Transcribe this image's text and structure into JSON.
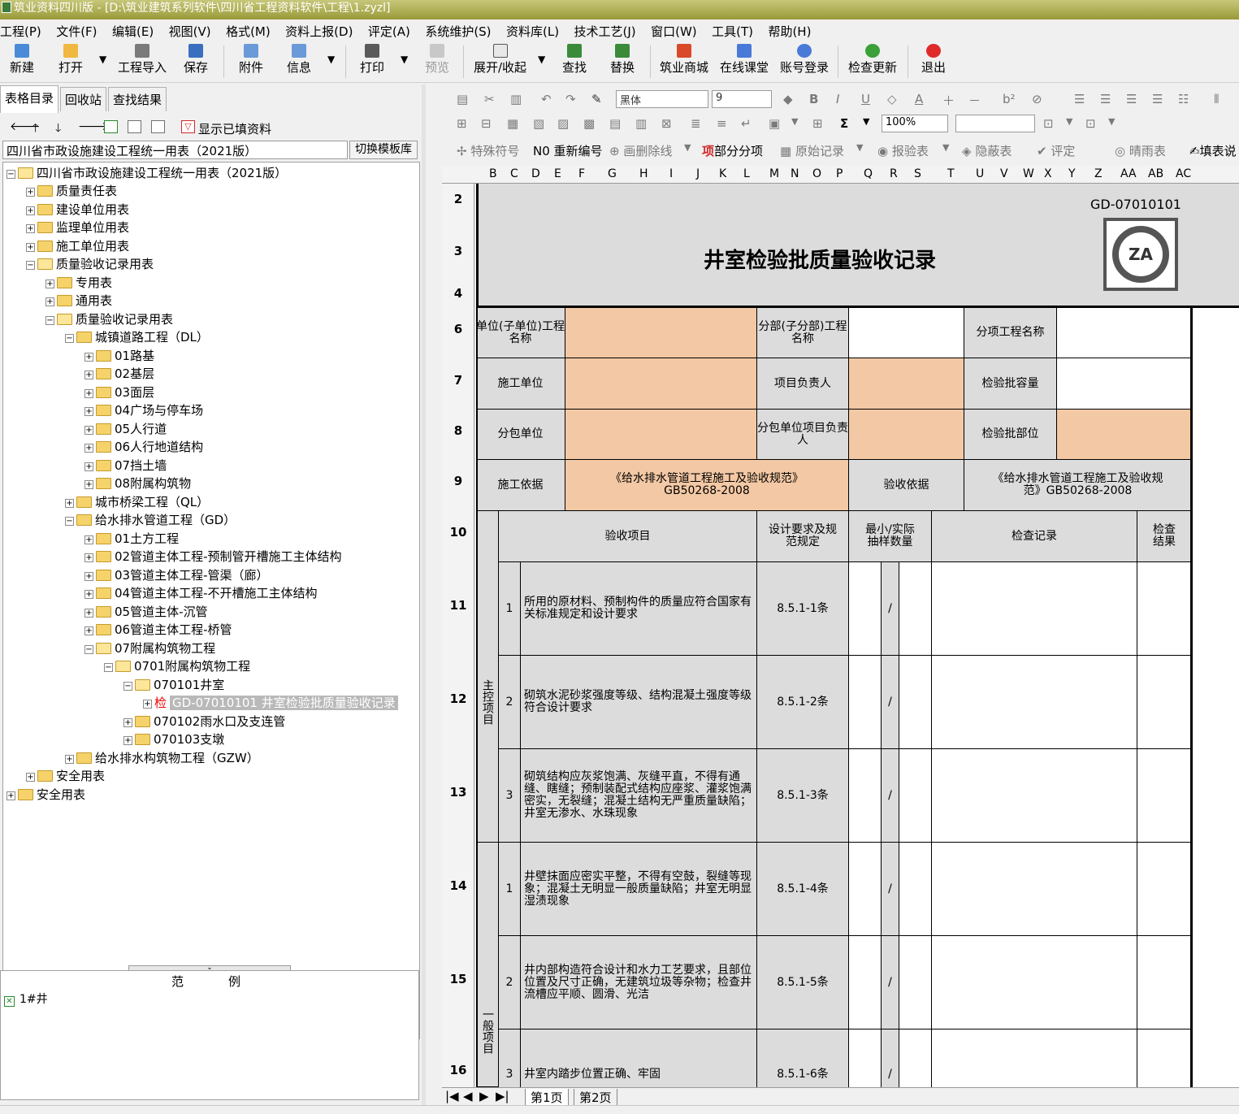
{
  "window": {
    "title": "筑业资料四川版 - [D:\\筑业建筑系列软件\\四川省工程资料软件\\工程\\1.zyzl]"
  },
  "menu": [
    "工程(P)",
    "文件(F)",
    "编辑(E)",
    "视图(V)",
    "格式(M)",
    "资料上报(D)",
    "评定(A)",
    "系统维护(S)",
    "资料库(L)",
    "技术工艺(J)",
    "窗口(W)",
    "工具(T)",
    "帮助(H)"
  ],
  "toolbar": {
    "new": "新建",
    "open": "打开",
    "import": "工程导入",
    "save": "保存",
    "attach": "附件",
    "info": "信息",
    "print": "打印",
    "preview": "预览",
    "expand": "展开/收起",
    "find": "查找",
    "replace": "替换",
    "mall": "筑业商城",
    "class": "在线课堂",
    "login": "账号登录",
    "update": "检查更新",
    "exit": "退出"
  },
  "left": {
    "tabs": [
      "表格目录",
      "回收站",
      "查找结果"
    ],
    "show_filled": "显示已填资料",
    "combo": "四川省市政设施建设工程统一用表（2021版）",
    "switch_template": "切换模板库",
    "tree": [
      "四川省市政设施建设工程统一用表（2021版）",
      "质量责任表",
      "建设单位用表",
      "监理单位用表",
      "施工单位用表",
      "质量验收记录用表",
      "专用表",
      "通用表",
      "质量验收记录用表",
      "城镇道路工程（DL）",
      "01路基",
      "02基层",
      "03面层",
      "04广场与停车场",
      "05人行道",
      "06人行地道结构",
      "07挡土墙",
      "08附属构筑物",
      "城市桥梁工程（QL）",
      "给水排水管道工程（GD）",
      "01土方工程",
      "02管道主体工程-预制管开槽施工主体结构",
      "03管道主体工程-管渠（廊）",
      "04管道主体工程-不开槽施工主体结构",
      "05管道主体-沉管",
      "06管道主体工程-桥管",
      "07附属构筑物工程",
      "0701附属构筑物工程",
      "070101井室",
      "GD-07010101 井室检验批质量验收记录",
      "070102雨水口及支连管",
      "070103支墩",
      "给水排水构筑物工程（GZW）",
      "安全用表",
      "安全用表"
    ],
    "check_mark": "检",
    "legend_title": "范例",
    "legend_item": "1#井"
  },
  "right": {
    "font": "黑体",
    "size": "9",
    "zoom": "100%",
    "tb3": [
      "特殊符号",
      "重新编号",
      "画删除线",
      "部分分项",
      "原始记录",
      "报验表",
      "隐蔽表",
      "评定",
      "晴雨表",
      "填表说"
    ],
    "columns": [
      "B",
      "C",
      "D",
      "E",
      "F",
      "G",
      "H",
      "I",
      "J",
      "K",
      "L",
      "M",
      "N",
      "O",
      "P",
      "Q",
      "R",
      "S",
      "T",
      "U",
      "V",
      "W",
      "X",
      "Y",
      "Z",
      "AA",
      "AB",
      "AC"
    ],
    "rows": [
      "2",
      "3",
      "4",
      "6",
      "7",
      "8",
      "9",
      "10",
      "11",
      "12",
      "13",
      "14",
      "15",
      "16"
    ],
    "sheet_tabs": [
      "第1页",
      "第2页"
    ]
  },
  "form": {
    "code": "GD-07010101",
    "logo": "ZA",
    "title": "井室检验批质量验收记录",
    "unit_name": "单位(子单位)工程名称",
    "sub_name": "分部(子分部)工程名称",
    "item_name": "分项工程名称",
    "builder": "施工单位",
    "pm": "项目负责人",
    "capacity": "检验批容量",
    "subcontract": "分包单位",
    "sub_pm": "分包单位项目负责人",
    "part": "检验批部位",
    "basis": "施工依据",
    "basis_text": "《给水排水管道工程施工及验收规范》GB50268-2008",
    "check_basis": "验收依据",
    "check_basis_text": "《给水排水管道工程施工及验收规范》GB50268-2008",
    "hdr_item": "验收项目",
    "hdr_req": "设计要求及规范规定",
    "hdr_sample": "最小/实际抽样数量",
    "hdr_record": "检查记录",
    "hdr_result": "检查结果",
    "main_label": "主控项目",
    "general_label": "一般项目",
    "slash": "/",
    "items": [
      {
        "no": "1",
        "text": "所用的原材料、预制构件的质量应符合国家有关标准规定和设计要求",
        "req": "8.5.1-1条"
      },
      {
        "no": "2",
        "text": "砌筑水泥砂浆强度等级、结构混凝土强度等级符合设计要求",
        "req": "8.5.1-2条"
      },
      {
        "no": "3",
        "text": "砌筑结构应灰浆饱满、灰缝平直，不得有通缝、瞎缝；预制装配式结构应座浆、灌浆饱满密实，无裂缝；混凝土结构无严重质量缺陷；井室无渗水、水珠现象",
        "req": "8.5.1-3条"
      },
      {
        "no": "1",
        "text": "井壁抹面应密实平整，不得有空鼓，裂缝等现象；混凝土无明显一般质量缺陷；井室无明显湿渍现象",
        "req": "8.5.1-4条"
      },
      {
        "no": "2",
        "text": "井内部构造符合设计和水力工艺要求，且部位位置及尺寸正确，无建筑垃圾等杂物；检查井流槽应平顺、圆滑、光洁",
        "req": "8.5.1-5条"
      },
      {
        "no": "3",
        "text": "井室内踏步位置正确、牢固",
        "req": "8.5.1-6条"
      }
    ]
  }
}
